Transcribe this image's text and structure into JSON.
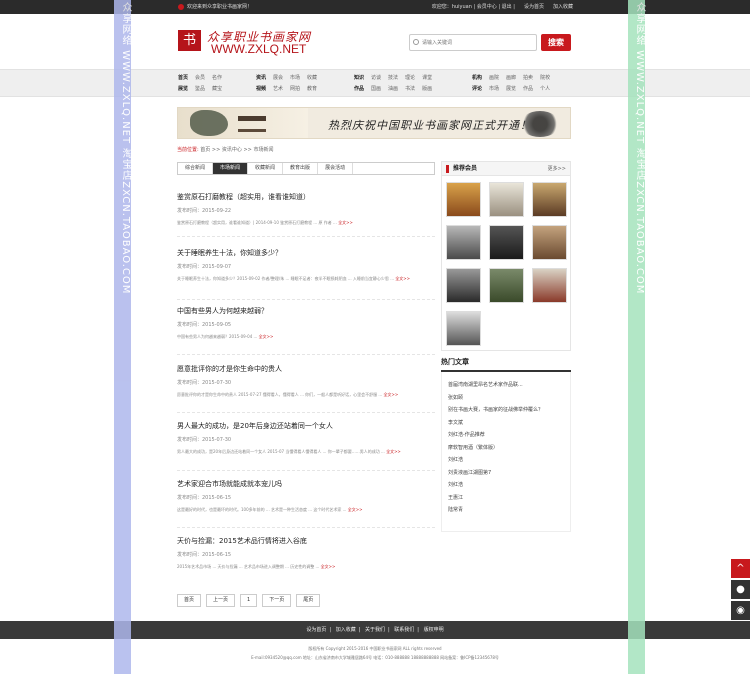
{
  "topbar": {
    "welcome": "欢迎来到众享职业书画家网！",
    "greeting": "欢迎您：",
    "user": "huiyuan",
    "member_center": "会员中心",
    "logout": "退出",
    "set_home": "设为首页",
    "add_favorite": "加入收藏"
  },
  "brand": {
    "logo_glyph": "书",
    "name_cn": "众享职业书画家网",
    "url": "WWW.ZXLQ.NET"
  },
  "search": {
    "placeholder": "请输入关键词",
    "button": "搜索"
  },
  "nav": {
    "group1": {
      "row1": [
        "首页",
        "会员",
        "名作"
      ],
      "row2": [
        "展览",
        "鉴品",
        "藏宝"
      ]
    },
    "group2": {
      "row1": [
        "资讯",
        "展会",
        "市场",
        "收藏"
      ],
      "row2": [
        "视频",
        "艺术",
        "网拍",
        "教育"
      ]
    },
    "group3": {
      "row1": [
        "知识",
        "访谈",
        "技法",
        "理论",
        "课堂"
      ],
      "row2": [
        "作品",
        "国画",
        "油画",
        "书法",
        "版画"
      ]
    },
    "group4": {
      "row1": [
        "机构",
        "画院",
        "画廊",
        "拍卖",
        "院校"
      ],
      "row2": [
        "评论",
        "市场",
        "展览",
        "作品",
        "个人"
      ]
    }
  },
  "banner": {
    "slogan": "热烈庆祝中国职业书画家网正式开通！"
  },
  "breadcrumb": {
    "current": "当前位置:",
    "home": "首页",
    "sep": ">>",
    "section": "资讯中心",
    "page": "市场新闻"
  },
  "tabs": [
    "综合新闻",
    "市场新闻",
    "收藏新闻",
    "教育出版",
    "展会活动"
  ],
  "articles": [
    {
      "title": "鉴赏原石打磨教程（超实用，谁看谁知道）",
      "date": "发布时间：2015-09-22",
      "summary": "鉴赏原石打磨教程（超实用，谁看谁知道）| 2014-09-10 鉴赏原石打磨教程 ... 原 作者 ...",
      "more": "全文>>"
    },
    {
      "title": "关于睡眠养生十法，你知道多少？",
      "date": "发布时间：2015-09-07",
      "summary": "关于睡眠养生十法，你知道多少？2015-09-02 作者/整理/朱 ... 睡眠不足者：夜半不眠损耗阴血 ... 入睡前当宜静心少思 ...",
      "more": "全文>>"
    },
    {
      "title": "中国有些男人为何越来越弱？",
      "date": "发布时间：2015-09-05",
      "summary": "中国有些男人为何越来越弱？2015-09-04 ...",
      "more": "全文>>"
    },
    {
      "title": "愿意批评你的才是你生命中的贵人",
      "date": "发布时间：2015-07-30",
      "summary": "愿意批评你的才是你生命中的贵人 2015-07-27 懂得看人，懂得看人 ... 你们，一般人都是听好话，心里会不舒服 ...",
      "more": "全文>>"
    },
    {
      "title": "男人最大的成功，是20年后身边还站着同一个女人",
      "date": "发布时间：2015-07-30",
      "summary": "男人最大的成功，是20年后身边还站着同一个女人 2015-07 当懂得看人懂得看人 ... 你一辈子都要……男人的成功 ...",
      "more": "全文>>"
    },
    {
      "title": "艺术家迎合市场就能成就本宠儿吗",
      "date": "发布时间：2015-06-15",
      "summary": "这是最好的时代，也是最坏的时代。100多年前的 ... 艺术是一种生活态度 ... 这个时代艺术家 ...",
      "more": "全文>>"
    },
    {
      "title": "天价与捡漏：2015艺术品行情将进入谷底",
      "date": "发布时间：2015-06-15",
      "summary": "2015年艺术品市场 ... 天价与捡漏 ... 艺术品市场进入调整期 ... 历史性的调整 ...",
      "more": "全文>>"
    }
  ],
  "pager": [
    "首页",
    "上一页",
    "1",
    "下一页",
    "尾页"
  ],
  "members": {
    "title": "推荐会员",
    "more": "更多>>"
  },
  "hot": {
    "title": "热门文章",
    "items": [
      "首届湾南湖里昂名艺术家作品联...",
      "张如颐",
      "别在书画大赛，书画家的征战佛举仲覆么？",
      "李文斌",
      "刘红浩-作品推荐",
      "摩软智用酒（繁体版）",
      "刘红浩",
      "刘贵液画江湖图第7",
      "刘红浩",
      "王惠江",
      "陆常青"
    ]
  },
  "footer": {
    "links": [
      "设为首页",
      "加入收藏",
      "关于我们",
      "联系我们",
      "版权申明"
    ],
    "copyright": "版权所有 Copyright 2015-2016 中国职业书画家网 ALL rights reserved",
    "contact": "E-mail:0934520@qq.com  地址：山东省济南市大学城雅居路64号  电话：010-888888  18888888888  网站备案：鲁ICP备12345678号"
  },
  "watermark": {
    "left": "众享网络 WWW.ZXLQ.NET 淘宝店ZXCN.TAOBAO.COM",
    "right": "众享网络 WWW.ZXLQ.NET 淘宝店ZXCN.TAOBAO.COM"
  },
  "float_buttons": [
    "up-arrow-icon",
    "user-icon",
    "wechat-icon"
  ],
  "colors": {
    "accent": "#c8191d",
    "topbar": "#2b2b2b",
    "footer": "#3a3a3a"
  }
}
